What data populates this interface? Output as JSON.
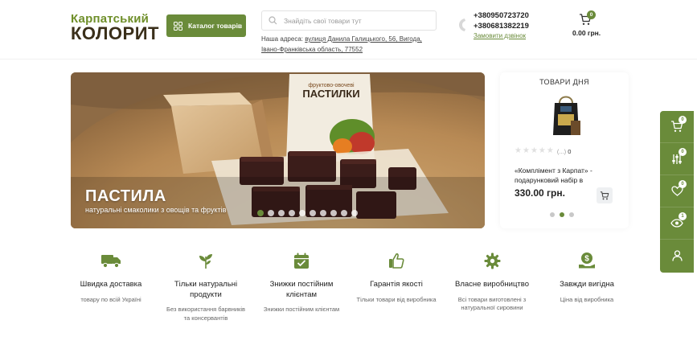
{
  "header": {
    "logo_line1": "Карпатський",
    "logo_line2": "КОЛОРИТ",
    "catalog_label": "Каталог товарів",
    "search_placeholder": "Знайдіть свої товари тут",
    "address_prefix": "Наша адреса: ",
    "address_link1": "вулиця Данила Галицького, 56, Вигода,",
    "address_link2": "Івано-Франківська область, 77552",
    "phone1": "+380950723720",
    "phone2": "+380681382219",
    "callback_label": "Замовити дзвінок",
    "cart_count": "0",
    "cart_total": "0.00 грн."
  },
  "banner": {
    "title": "ПАСТИЛА",
    "subtitle": "натуральні смаколики з овощів та фруктів",
    "package_label_small": "фруктово-овочеві",
    "package_label_big": "ПАСТИЛКИ",
    "dots_count": 10,
    "active_dot": 0
  },
  "deal": {
    "heading": "ТОВАРИ ДНЯ",
    "rating_stars": 0,
    "rating_count": "0",
    "name": "«Комплімент з Карпат» - подарунковий набір в",
    "price": "330.00 грн.",
    "active_dot": 1
  },
  "side_panel": {
    "cart_badge": "0",
    "compare_badge": "0",
    "wishlist_badge": "0",
    "viewed_badge": "1"
  },
  "features": [
    {
      "icon": "truck-icon",
      "title": "Швидка доставка",
      "desc": "товару по всій Україні"
    },
    {
      "icon": "sprout-icon",
      "title": "Тільки натуральні продукти",
      "desc": "Без використання барвників та консервантів"
    },
    {
      "icon": "calendar-check-icon",
      "title": "Знижки постійним клієнтам",
      "desc": "Знижки постійним клієнтам"
    },
    {
      "icon": "thumbs-up-icon",
      "title": "Гарантія якості",
      "desc": "Тільки товари від виробника"
    },
    {
      "icon": "gear-icon",
      "title": "Власне виробництво",
      "desc": "Всі товари виготовлені з натуральної сировини"
    },
    {
      "icon": "money-hand-icon",
      "title": "Завжди вигідна",
      "desc": "Ціна від виробника"
    }
  ],
  "colors": {
    "accent": "#6a8b3a",
    "text": "#2b2b2b"
  }
}
